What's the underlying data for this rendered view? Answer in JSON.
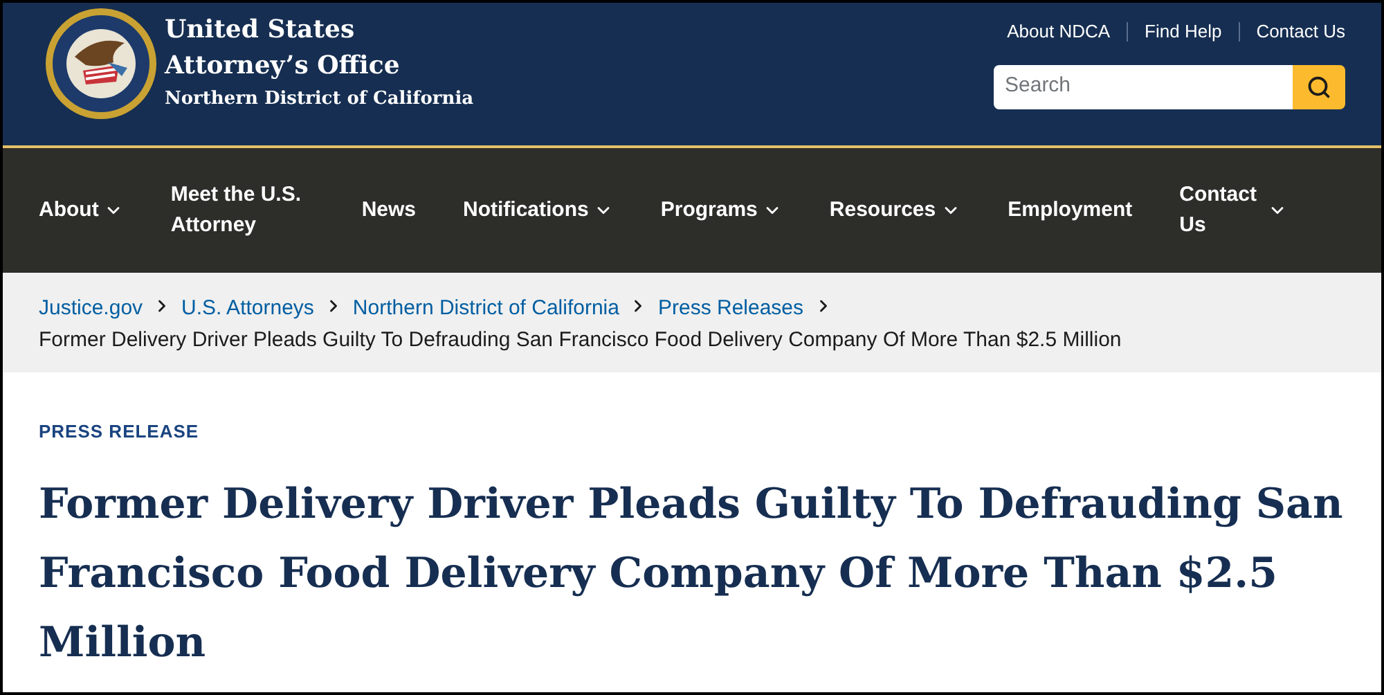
{
  "header": {
    "title_lines": [
      "United States",
      "Attorney’s Office"
    ],
    "subtitle": "Northern District of California",
    "utility_links": [
      "About NDCA",
      "Find Help",
      "Contact Us"
    ],
    "search": {
      "placeholder": "Search"
    }
  },
  "nav": [
    {
      "label": "About",
      "has_menu": true
    },
    {
      "label": "Meet the U.S. Attorney",
      "has_menu": false
    },
    {
      "label": "News",
      "has_menu": false
    },
    {
      "label": "Notifications",
      "has_menu": true
    },
    {
      "label": "Programs",
      "has_menu": true
    },
    {
      "label": "Resources",
      "has_menu": true
    },
    {
      "label": "Employment",
      "has_menu": false
    },
    {
      "label": "Contact Us",
      "has_menu": true
    }
  ],
  "breadcrumb": {
    "links": [
      "Justice.gov",
      "U.S. Attorneys",
      "Northern District of California",
      "Press Releases"
    ],
    "current": "Former Delivery Driver Pleads Guilty To Defrauding San Francisco Food Delivery Company Of More Than $2.5 Million"
  },
  "article": {
    "eyebrow": "PRESS RELEASE",
    "title": "Former Delivery Driver Pleads Guilty To Defrauding San Francisco Food Delivery Company Of More Than $2.5 Million"
  }
}
